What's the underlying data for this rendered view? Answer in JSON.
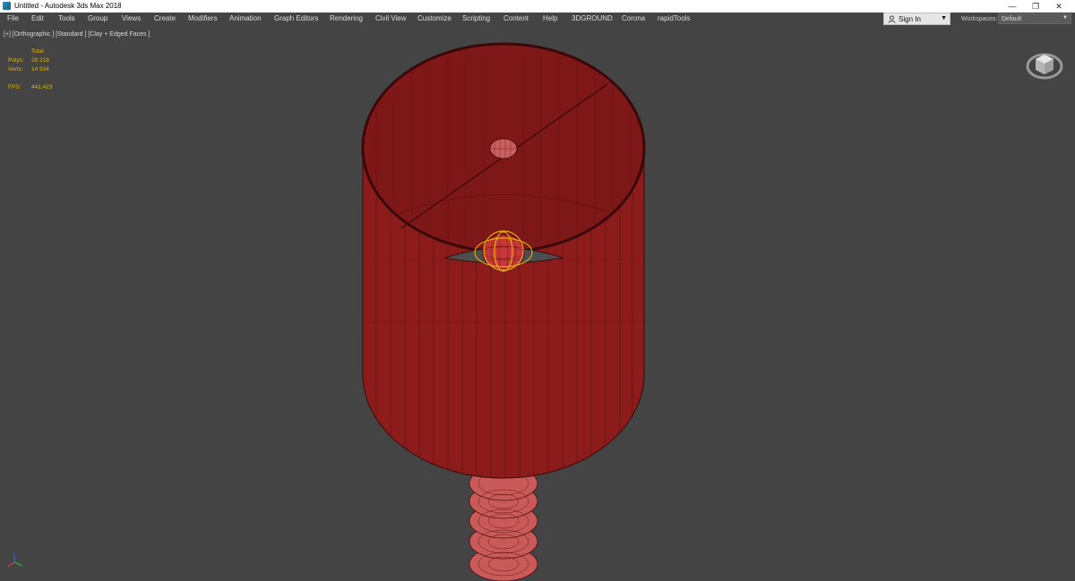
{
  "window": {
    "title": "Untitled - Autodesk 3ds Max 2018",
    "controls": {
      "minimize": "—",
      "restore": "❐",
      "close": "✕"
    }
  },
  "menu": {
    "items": [
      "File",
      "Edit",
      "Tools",
      "Group",
      "Views",
      "Create",
      "Modifiers",
      "Animation",
      "Graph Editors",
      "Rendering",
      "Civil View",
      "Customize",
      "Scripting",
      "Content",
      "Help",
      "3DGROUND",
      "Corona",
      "rapidTools"
    ]
  },
  "account": {
    "sign_in_label": "Sign In"
  },
  "workspaces": {
    "label": "Workspaces:",
    "value": "Default"
  },
  "viewport": {
    "label": "[+] [Orthographic ] [Standard ] [Clay + Edged Faces ]",
    "stats": {
      "total_label": "Total",
      "polys_label": "Polys:",
      "polys_value": "28 218",
      "verts_label": "Verts:",
      "verts_value": "14 934",
      "fps_label": "FPS:",
      "fps_value": "441,423"
    }
  },
  "colors": {
    "ui_background": "#444444",
    "stats_text": "#e3b400",
    "mesh_fill": "#8a1c1c",
    "wire": "#4a0b0b",
    "selection": "#f0c000"
  },
  "icons": {
    "app": "3ds-max-logo-icon",
    "user": "user-icon",
    "viewcube": "viewcube-icon",
    "axis": "axis-tripod-icon"
  }
}
